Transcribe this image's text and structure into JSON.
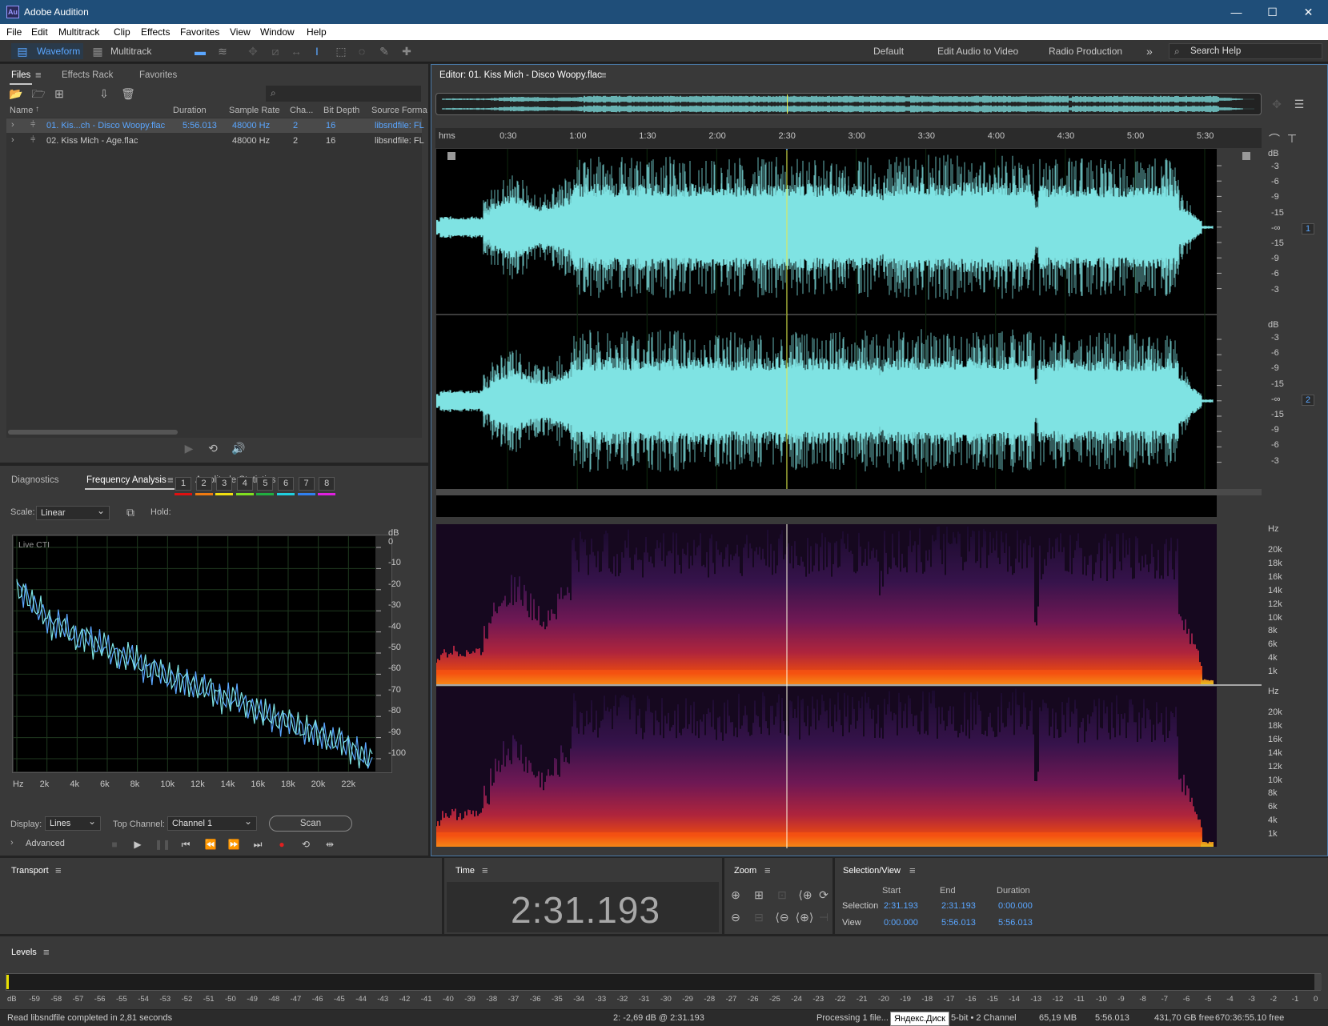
{
  "window": {
    "title": "Adobe Audition",
    "logo": "Au",
    "minimize": "—",
    "maximize": "☐",
    "close": "✕"
  },
  "menu": [
    "File",
    "Edit",
    "Multitrack",
    "Clip",
    "Effects",
    "Favorites",
    "View",
    "Window",
    "Help"
  ],
  "toolbar": {
    "waveform": "Waveform",
    "multitrack": "Multitrack",
    "workspaces": [
      "Default",
      "Edit Audio to Video",
      "Radio Production"
    ],
    "more": "»",
    "search_placeholder": "Search Help"
  },
  "files_panel": {
    "tabs": [
      "Files",
      "Effects Rack",
      "Favorites"
    ],
    "columns": [
      "Name",
      "Duration",
      "Sample Rate",
      "Cha...",
      "Bit Depth",
      "Source Forma"
    ],
    "rows": [
      {
        "name": "01. Kis...ch - Disco Woopy.flac",
        "duration": "5:56.013",
        "rate": "48000 Hz",
        "ch": "2",
        "depth": "16",
        "format": "libsndfile: FL",
        "selected": true
      },
      {
        "name": "02. Kiss Mich - Age.flac",
        "duration": "",
        "rate": "48000 Hz",
        "ch": "2",
        "depth": "16",
        "format": "libsndfile: FL",
        "selected": false
      }
    ]
  },
  "analysis_panel": {
    "tabs": [
      "Diagnostics",
      "Frequency Analysis",
      "Amplitude Statistics"
    ],
    "scale_label": "Scale:",
    "scale_value": "Linear",
    "hold_label": "Hold:",
    "hold_buttons": [
      "1",
      "2",
      "3",
      "4",
      "5",
      "6",
      "7",
      "8"
    ],
    "hold_colors": [
      "#e01010",
      "#f07a10",
      "#f0e010",
      "#80e020",
      "#20b040",
      "#20d0e0",
      "#3080f0",
      "#e020e0"
    ],
    "graph_label": "Live CTI",
    "db_label": "dB",
    "db_ticks": [
      "0",
      "-10",
      "-20",
      "-30",
      "-40",
      "-50",
      "-60",
      "-70",
      "-80",
      "-90",
      "-100"
    ],
    "hz_ticks": [
      "Hz",
      "2k",
      "4k",
      "6k",
      "8k",
      "10k",
      "12k",
      "14k",
      "16k",
      "18k",
      "20k",
      "22k"
    ],
    "display_label": "Display:",
    "display_value": "Lines",
    "top_channel_label": "Top Channel:",
    "top_channel_value": "Channel 1",
    "scan": "Scan",
    "advanced": "Advanced",
    "spectrum_db": [
      -19,
      -22,
      -28,
      -31,
      -37,
      -36,
      -40,
      -44,
      -41,
      -47,
      -46,
      -50,
      -52,
      -51,
      -55,
      -58,
      -57,
      -61,
      -63,
      -62,
      -65,
      -67,
      -66,
      -70,
      -72,
      -71,
      -74,
      -76,
      -78,
      -80,
      -82,
      -81,
      -85,
      -87,
      -86,
      -89,
      -92,
      -91,
      -94,
      -97,
      -100
    ]
  },
  "editor": {
    "title": "Editor: 01. Kiss Mich - Disco Woopy.flac",
    "time_unit": "hms",
    "time_ticks": [
      "0:30",
      "1:00",
      "1:30",
      "2:00",
      "2:30",
      "3:00",
      "3:30",
      "4:00",
      "4:30",
      "5:00",
      "5:30"
    ],
    "db_label": "dB",
    "db_scale": [
      "-3",
      "-6",
      "-9",
      "-15",
      "-∞",
      "-15",
      "-9",
      "-6",
      "-3"
    ],
    "channels": [
      "1",
      "2"
    ],
    "hz_label": "Hz",
    "hz_scale": [
      "20k",
      "18k",
      "16k",
      "14k",
      "12k",
      "10k",
      "8k",
      "6k",
      "4k",
      "1k"
    ],
    "playhead_seconds": 151.193,
    "total_seconds": 356.013,
    "colors": {
      "waveform": "#7fe3e3",
      "playhead": "#e8e84a"
    }
  },
  "transport": {
    "title": "Transport"
  },
  "time_panel": {
    "title": "Time",
    "value": "2:31.193"
  },
  "zoom_panel": {
    "title": "Zoom"
  },
  "selection_panel": {
    "title": "Selection/View",
    "cols": [
      "Start",
      "End",
      "Duration"
    ],
    "rows": [
      {
        "label": "Selection",
        "start": "2:31.193",
        "end": "2:31.193",
        "duration": "0:00.000"
      },
      {
        "label": "View",
        "start": "0:00.000",
        "end": "5:56.013",
        "duration": "5:56.013"
      }
    ]
  },
  "levels": {
    "title": "Levels",
    "scale": [
      "dB",
      "-59",
      "-58",
      "-57",
      "-56",
      "-55",
      "-54",
      "-53",
      "-52",
      "-51",
      "-50",
      "-49",
      "-48",
      "-47",
      "-46",
      "-45",
      "-44",
      "-43",
      "-42",
      "-41",
      "-40",
      "-39",
      "-38",
      "-37",
      "-36",
      "-35",
      "-34",
      "-33",
      "-32",
      "-31",
      "-30",
      "-29",
      "-28",
      "-27",
      "-26",
      "-25",
      "-24",
      "-23",
      "-22",
      "-21",
      "-20",
      "-19",
      "-18",
      "-17",
      "-16",
      "-15",
      "-14",
      "-13",
      "-12",
      "-11",
      "-10",
      "-9",
      "-8",
      "-7",
      "-6",
      "-5",
      "-4",
      "-3",
      "-2",
      "-1",
      "0"
    ]
  },
  "status": {
    "left": "Read libsndfile completed in 2,81 seconds",
    "cursor": "2: -2,69 dB @ 2:31.193",
    "processing": "Processing 1 file...",
    "tooltip": "Яндекс.Диск",
    "format": "5-bit • 2 Channel",
    "size": "65,19 MB",
    "duration": "5:56.013",
    "free": "431,70 GB free",
    "time_free": "670:36:55.10 free"
  }
}
